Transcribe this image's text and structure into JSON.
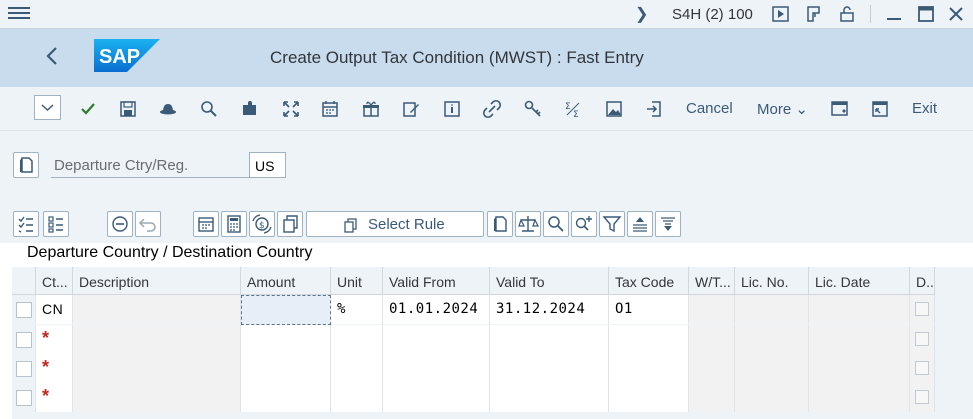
{
  "system": {
    "name": "S4H (2) 100"
  },
  "header": {
    "title": "Create Output Tax Condition (MWST) : Fast Entry",
    "logo_text": "SAP"
  },
  "toolbar": {
    "cancel": "Cancel",
    "more": "More",
    "exit": "Exit"
  },
  "fields": {
    "departure_label": "Departure Ctry/Reg.",
    "departure_value": "US"
  },
  "table_toolbar": {
    "select_rule": "Select Rule"
  },
  "section": {
    "title": "Departure Country / Destination Country"
  },
  "table": {
    "columns": [
      "Ct...",
      "Description",
      "Amount",
      "Unit",
      "Valid From",
      "Valid To",
      "Tax Code",
      "W/T...",
      "Lic. No.",
      "Lic. Date",
      "D..."
    ],
    "rows": [
      {
        "ct": "CN",
        "description": "",
        "amount": "",
        "unit": "%",
        "valid_from": "01.01.2024",
        "valid_to": "31.12.2024",
        "tax_code": "O1"
      },
      {
        "ct": "*"
      },
      {
        "ct": "*"
      },
      {
        "ct": "*"
      }
    ]
  }
}
